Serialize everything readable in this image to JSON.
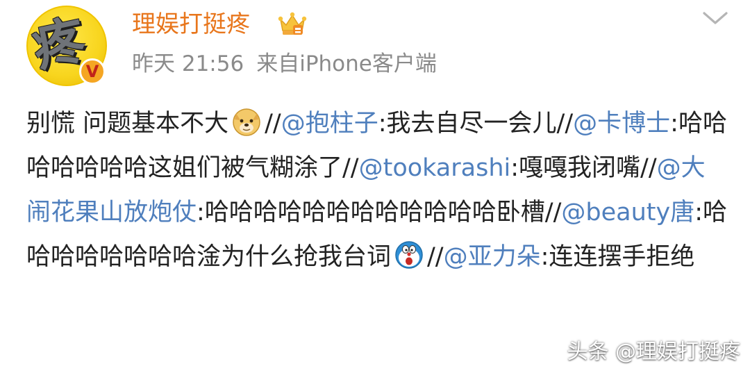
{
  "header": {
    "avatar_char": "疼",
    "verified_mark": "V",
    "username": "理娱打挺疼",
    "vip_icon": "crown-vip-icon",
    "time": "昨天 21:56",
    "source": "来自iPhone客户端",
    "menu_icon": "chevron-down-icon"
  },
  "post": {
    "segments": [
      {
        "type": "text",
        "text": "别慌 问题基本不大"
      },
      {
        "type": "emoji",
        "icon": "doge-emoji-icon"
      },
      {
        "type": "text",
        "text": "//"
      },
      {
        "type": "mention",
        "text": "@抱柱子"
      },
      {
        "type": "text",
        "text": ":我去自尽一会儿//"
      },
      {
        "type": "mention",
        "text": "@卡博士"
      },
      {
        "type": "text",
        "text": ":哈哈哈哈哈哈哈这姐们被气糊涂了//"
      },
      {
        "type": "mention",
        "text": "@tookarashi"
      },
      {
        "type": "text",
        "text": ":嘎嘎我闭嘴//"
      },
      {
        "type": "mention",
        "text": "@大闹花果山放炮仗"
      },
      {
        "type": "text",
        "text": ":哈哈哈哈哈哈哈哈哈哈哈哈卧槽//"
      },
      {
        "type": "mention",
        "text": "@beauty唐"
      },
      {
        "type": "text",
        "text": ":哈哈哈哈哈哈哈哈淦为什么抢我台词"
      },
      {
        "type": "emoji",
        "icon": "doraemon-emoji-icon"
      },
      {
        "type": "text",
        "text": "//"
      },
      {
        "type": "mention",
        "text": "@亚力朵"
      },
      {
        "type": "text",
        "text": ":连连摆手拒绝"
      }
    ]
  },
  "watermark": "头条 @理娱打挺疼",
  "colors": {
    "username": "#e8761c",
    "mention": "#4f7fbd",
    "meta": "#8a8a8a",
    "text": "#222222"
  }
}
